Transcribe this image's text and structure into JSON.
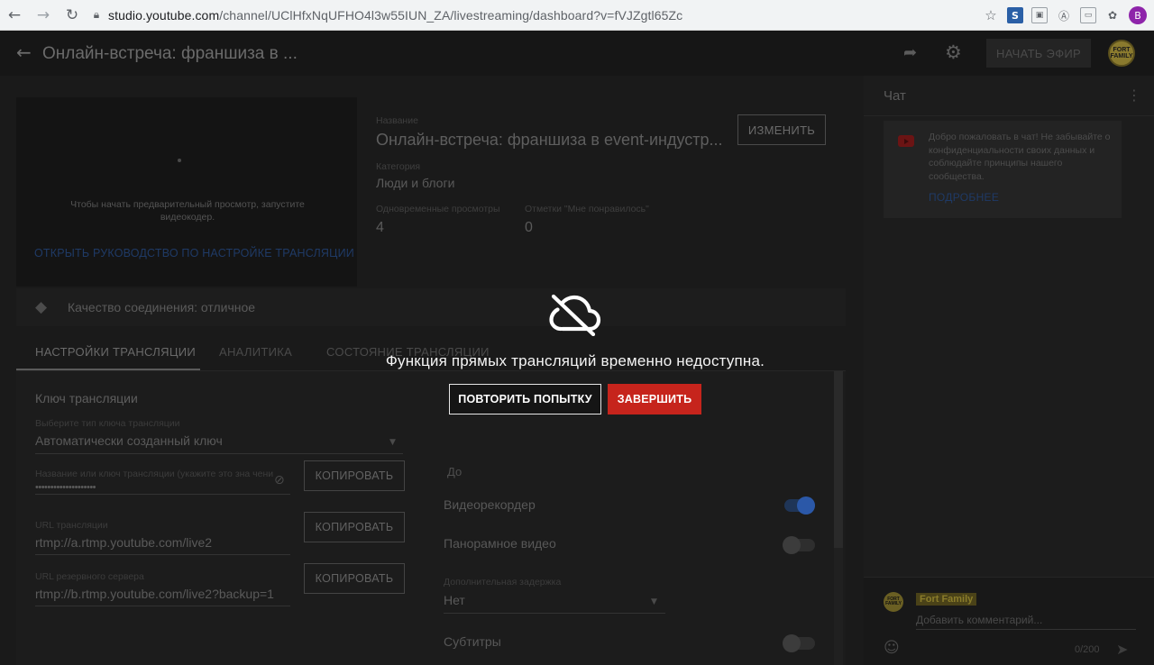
{
  "browser": {
    "url_host": "studio.youtube.com",
    "url_path": "/channel/UClHfxNqUFHO4l3w55IUN_ZA/livestreaming/dashboard?v=fVJZgtl65Zc",
    "profile_letter": "B"
  },
  "header": {
    "title": "Онлайн-встреча: франшиза в ...",
    "go_live_label": "НАЧАТЬ ЭФИР",
    "channel_logo_text": "FORT FAMILY"
  },
  "preview": {
    "message": "Чтобы начать предварительный просмотр, запустите видеокодер.",
    "guide_link": "ОТКРЫТЬ РУКОВОДСТВО ПО НАСТРОЙКЕ ТРАНСЛЯЦИИ"
  },
  "stream_info": {
    "title_label": "Название",
    "title_value": "Онлайн-встреча: франшиза в event-индустр...",
    "edit_label": "ИЗМЕНИТЬ",
    "category_label": "Категория",
    "category_value": "Люди и блоги",
    "concurrent_label": "Одновременные просмотры",
    "concurrent_value": "4",
    "likes_label": "Отметки \"Мне понравилось\"",
    "likes_value": "0"
  },
  "connection": {
    "quality_text": "Качество соединения: отличное"
  },
  "tabs": [
    {
      "label": "НАСТРОЙКИ ТРАНСЛЯЦИИ"
    },
    {
      "label": "АНАЛИТИКА"
    },
    {
      "label": "СОСТОЯНИЕ ТРАНСЛЯЦИИ"
    }
  ],
  "settings": {
    "heading": "Ключ трансляции",
    "key_type_label": "Выберите тип ключа трансляции",
    "key_type_value": "Автоматически созданный ключ",
    "key_name_label": "Название или ключ трансляции (укажите это зна чени",
    "key_masked": "••••••••••••••••••••",
    "copy_label": "КОПИРОВАТЬ",
    "url_label": "URL трансляции",
    "url_value": "rtmp://a.rtmp.youtube.com/live2",
    "backup_label": "URL резервного сервера",
    "backup_value": "rtmp://b.rtmp.youtube.com/live2?backup=1",
    "right_heading": "До",
    "dvr_label": "Видеорекордер",
    "dvr_on": true,
    "panorama_label": "Панорамное видео",
    "panorama_on": false,
    "latency_label": "Дополнительная задержка",
    "latency_value": "Нет",
    "subtitles_label": "Субтитры",
    "subtitles_on": false
  },
  "chat": {
    "title": "Чат",
    "welcome": "Добро пожаловать в чат! Не забывайте о конфиденциальности своих данных и соблюдайте принципы нашего сообщества.",
    "more_link": "ПОДРОБНЕЕ",
    "author": "Fort Family",
    "avatar_text": "FORT FAMILY",
    "comment_placeholder": "Добавить комментарий...",
    "char_count": "0/200"
  },
  "error": {
    "message": "Функция прямых трансляций временно недоступна.",
    "retry_label": "ПОВТОРИТЬ ПОПЫТКУ",
    "finish_label": "ЗАВЕРШИТЬ",
    "accent_color": "#c6241c"
  }
}
